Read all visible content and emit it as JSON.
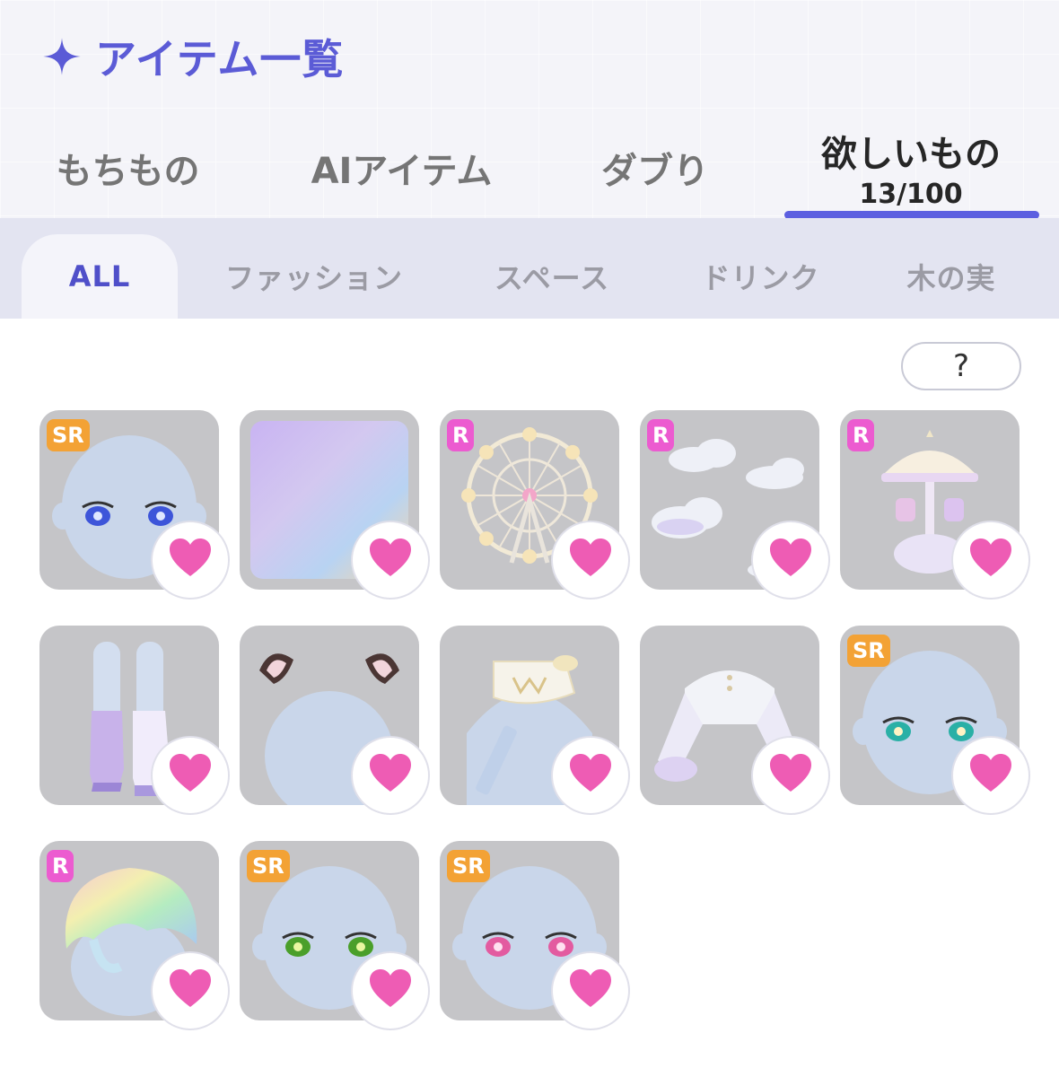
{
  "header": {
    "title": "アイテム一覧",
    "tabs": [
      {
        "label": "もちもの"
      },
      {
        "label": "AIアイテム"
      },
      {
        "label": "ダブり"
      },
      {
        "label": "欲しいもの",
        "count": "13/100"
      }
    ]
  },
  "categories": [
    "ALL",
    "ファッション",
    "スペース",
    "ドリンク",
    "木の実"
  ],
  "help_label": "?",
  "colors": {
    "accent": "#5c5fe0",
    "heart": "#ee5cb4",
    "badge_sr": "#f3a235",
    "badge_r": "#ec5bd0"
  },
  "items": [
    {
      "rarity": "SR",
      "icon": "face-blue-eyes-icon"
    },
    {
      "rarity": "",
      "icon": "pastel-gradient-background-icon"
    },
    {
      "rarity": "R",
      "icon": "ferris-wheel-icon"
    },
    {
      "rarity": "R",
      "icon": "clouds-icon"
    },
    {
      "rarity": "R",
      "icon": "carousel-icon"
    },
    {
      "rarity": "",
      "icon": "boots-icon"
    },
    {
      "rarity": "",
      "icon": "animal-ears-icon"
    },
    {
      "rarity": "",
      "icon": "collar-cape-icon"
    },
    {
      "rarity": "",
      "icon": "frilly-sleeves-icon"
    },
    {
      "rarity": "SR",
      "icon": "face-teal-eyes-icon"
    },
    {
      "rarity": "R",
      "icon": "rainbow-hair-icon"
    },
    {
      "rarity": "SR",
      "icon": "face-green-eyes-icon"
    },
    {
      "rarity": "SR",
      "icon": "face-pink-eyes-icon"
    }
  ]
}
